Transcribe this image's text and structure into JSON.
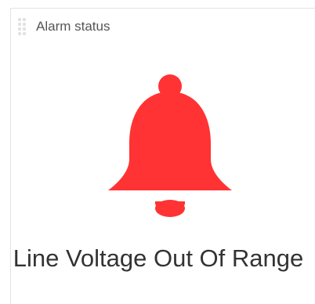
{
  "widget": {
    "title": "Alarm status",
    "status_text": "Line Voltage Out Of Range",
    "icon": "bell-icon",
    "alarm_color": "#ff3333"
  }
}
